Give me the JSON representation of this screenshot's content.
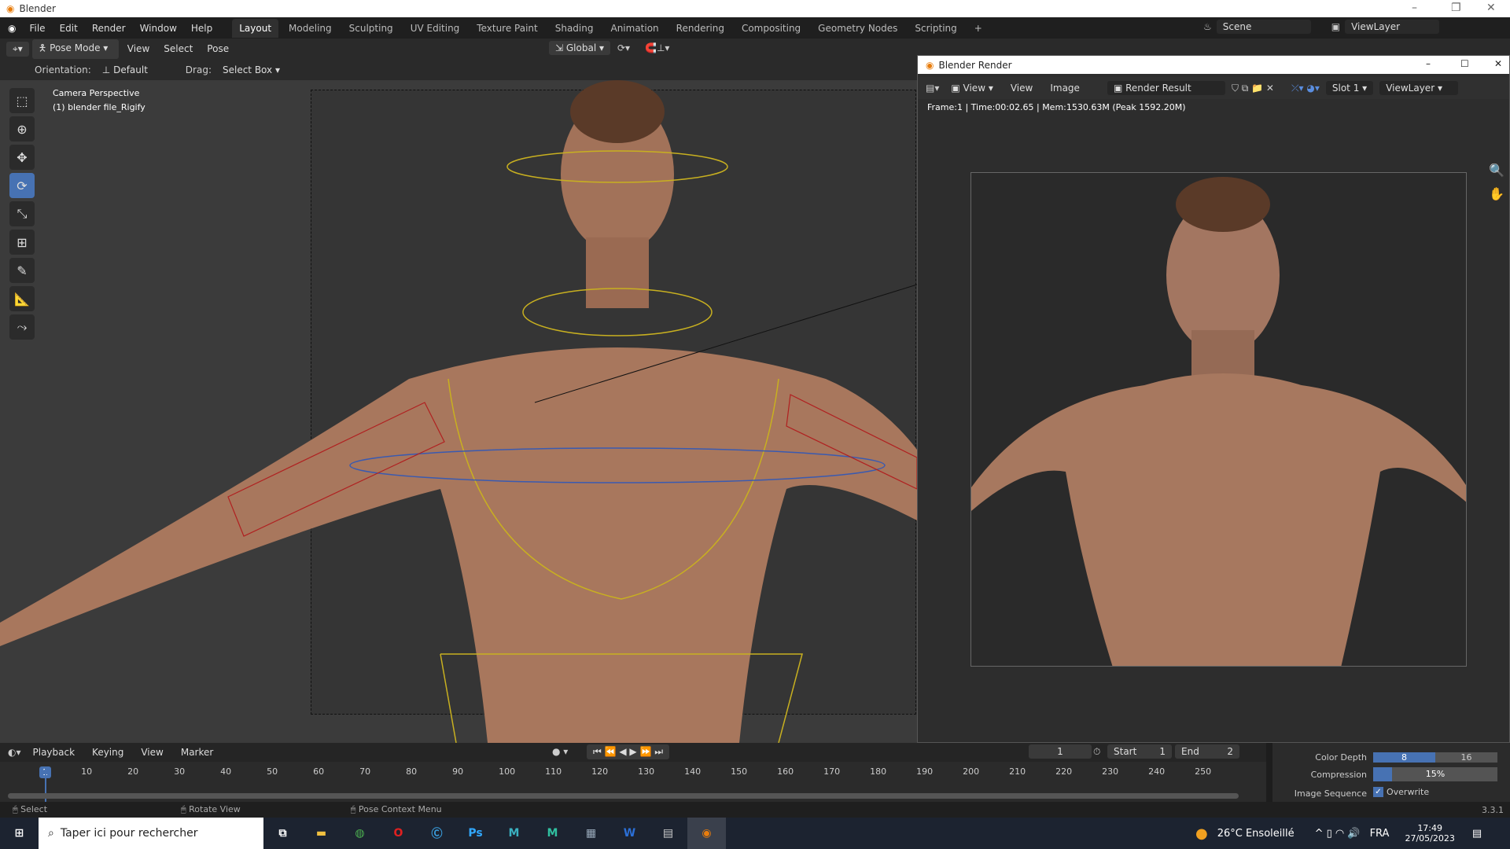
{
  "app": {
    "title": "Blender"
  },
  "menu": [
    "File",
    "Edit",
    "Render",
    "Window",
    "Help"
  ],
  "workspaces": [
    "Layout",
    "Modeling",
    "Sculpting",
    "UV Editing",
    "Texture Paint",
    "Shading",
    "Animation",
    "Rendering",
    "Compositing",
    "Geometry Nodes",
    "Scripting"
  ],
  "scene": "Scene",
  "view_layer": "ViewLayer",
  "header": {
    "mode": "Pose Mode",
    "menus": [
      "View",
      "Select",
      "Pose"
    ],
    "transform": "Global"
  },
  "tool_settings": {
    "orientation_label": "Orientation:",
    "orientation": "Default",
    "drag_label": "Drag:",
    "drag": "Select Box"
  },
  "viewport": {
    "camera": "Camera Perspective",
    "object": "(1) blender file_Rigify"
  },
  "render_window": {
    "title": "Blender Render",
    "menus": [
      "View",
      "View",
      "Image"
    ],
    "image": "Render Result",
    "slot": "Slot 1",
    "layer": "ViewLayer",
    "info": "Frame:1 | Time:00:02.65 | Mem:1530.63M (Peak 1592.20M)"
  },
  "timeline": {
    "menus": [
      "Playback",
      "Keying",
      "View",
      "Marker"
    ],
    "current_frame": "1",
    "start_label": "Start",
    "start": "1",
    "end_label": "End",
    "end": "2",
    "ticks": [
      "1",
      "10",
      "20",
      "30",
      "40",
      "50",
      "60",
      "70",
      "80",
      "90",
      "100",
      "110",
      "120",
      "130",
      "140",
      "150",
      "160",
      "170",
      "180",
      "190",
      "200",
      "210",
      "220",
      "230",
      "240",
      "250"
    ]
  },
  "props": {
    "color_depth_label": "Color Depth",
    "depth_8": "8",
    "depth_16": "16",
    "compression_label": "Compression",
    "compression": "15%",
    "compression_value": 0.15,
    "image_sequence_label": "Image Sequence",
    "overwrite": "Overwrite"
  },
  "status": {
    "select": "Select",
    "rotate": "Rotate View",
    "context": "Pose Context Menu",
    "version": "3.3.1"
  },
  "taskbar": {
    "search": "Taper ici pour rechercher",
    "weather": "26°C  Ensoleillé",
    "lang": "FRA",
    "time": "17:49",
    "date": "27/05/2023"
  }
}
